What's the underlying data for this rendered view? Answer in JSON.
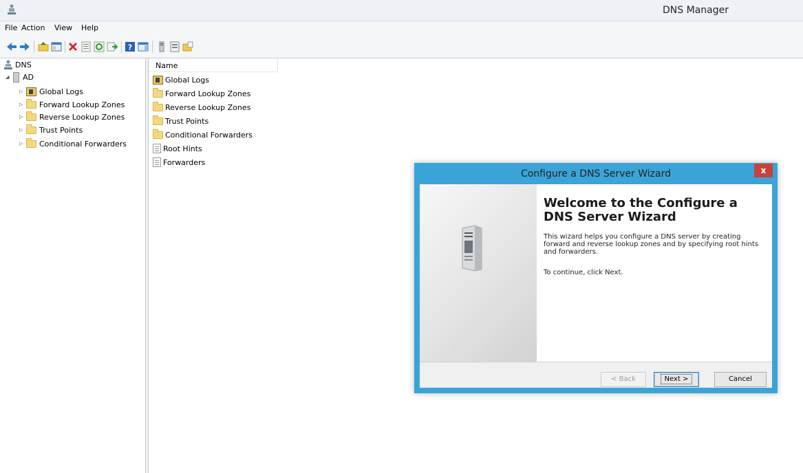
{
  "window": {
    "title": "DNS Manager"
  },
  "menu": [
    "File",
    "Action",
    "View",
    "Help"
  ],
  "toolbar": {
    "buttons": [
      "back",
      "forward",
      "up",
      "show-hide-console-tree",
      "delete",
      "properties",
      "refresh",
      "export-list",
      "help",
      "show-hide-action-pane",
      "server-properties",
      "filter",
      "new-zone"
    ]
  },
  "tree": {
    "root": "DNS",
    "server": "AD",
    "children": [
      "Global Logs",
      "Forward Lookup Zones",
      "Reverse Lookup Zones",
      "Trust Points",
      "Conditional Forwarders"
    ]
  },
  "list": {
    "column_name": "Name",
    "items": [
      "Global Logs",
      "Forward Lookup Zones",
      "Reverse Lookup Zones",
      "Trust Points",
      "Conditional Forwarders",
      "Root Hints",
      "Forwarders"
    ]
  },
  "wizard": {
    "title": "Configure a DNS Server Wizard",
    "close": "x",
    "heading": "Welcome to the Configure a DNS Server Wizard",
    "description": "This wizard helps you configure a DNS server by creating forward and reverse lookup zones and by specifying root hints and forwarders.",
    "continue_text": "To continue, click Next.",
    "back_label": "< Back",
    "next_label": "Next >",
    "cancel_label": "Cancel"
  }
}
